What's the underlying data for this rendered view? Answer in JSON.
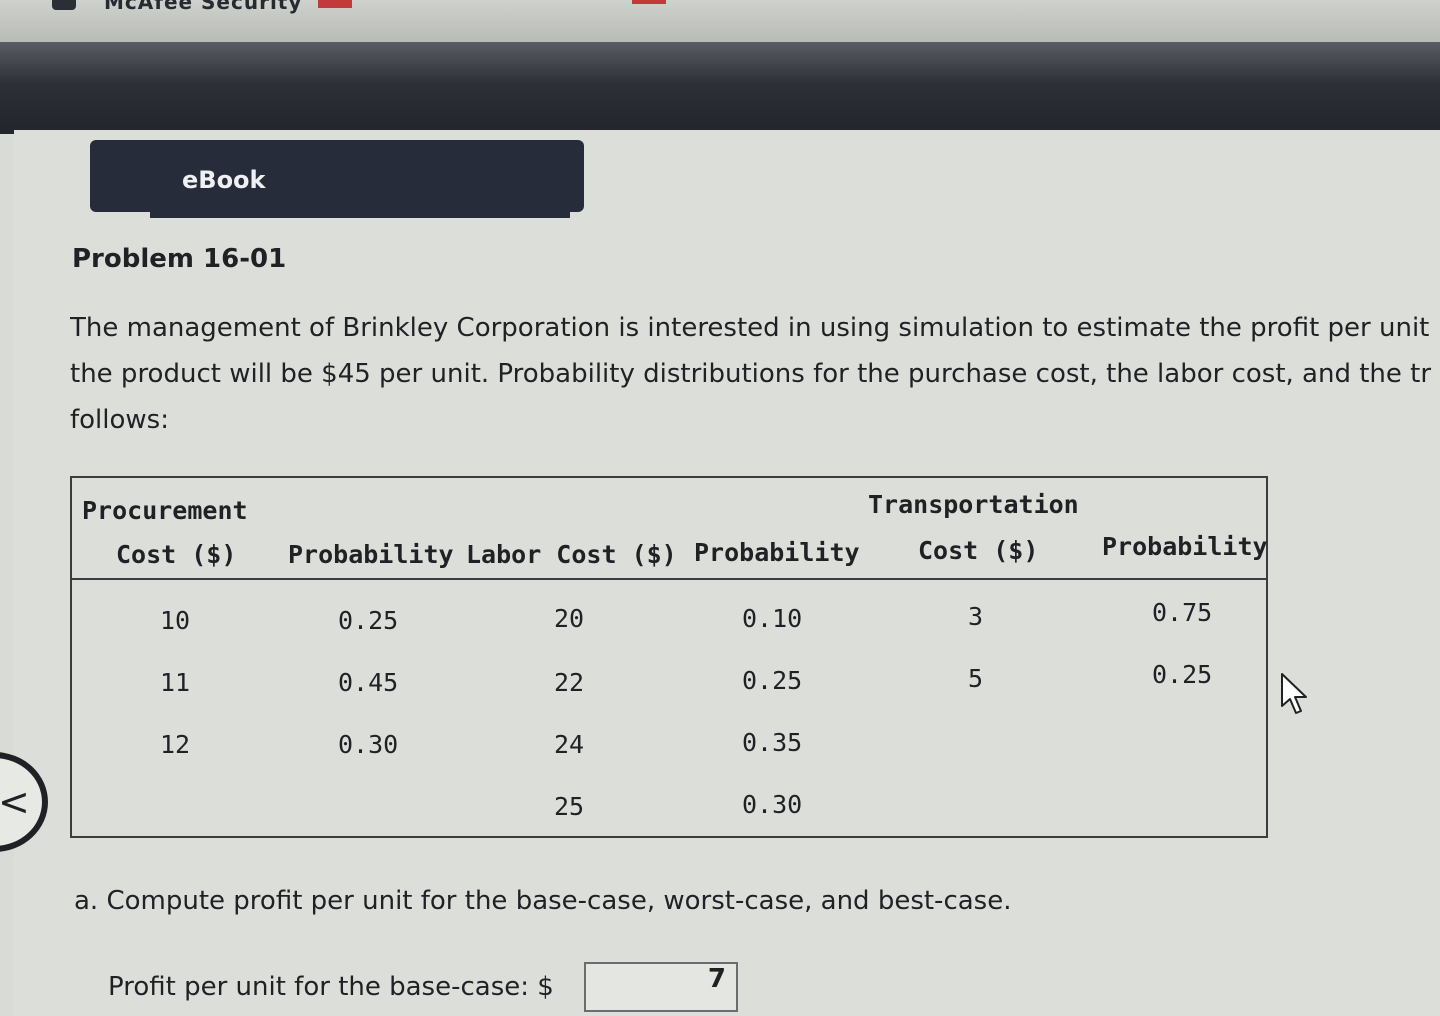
{
  "browser": {
    "brand": "McAfee Security"
  },
  "ebook": {
    "label": "eBook"
  },
  "problem": {
    "title": "Problem 16-01",
    "lines": [
      "The management of Brinkley Corporation is interested in using simulation to estimate the profit per unit",
      "the product will be $45 per unit. Probability distributions for the purchase cost, the labor cost, and the tr",
      "follows:"
    ]
  },
  "table": {
    "headers": {
      "c1a": "Procurement",
      "c1b": "Cost ($)",
      "c2": "Probability",
      "c3": "Labor Cost ($)",
      "c4": "Probability",
      "c5a": "Transportation",
      "c5b": "Cost ($)",
      "c6": "Probability"
    },
    "rows": [
      [
        "10",
        "0.25",
        "20",
        "0.10",
        "3",
        "0.75"
      ],
      [
        "11",
        "0.45",
        "22",
        "0.25",
        "5",
        "0.25"
      ],
      [
        "12",
        "0.30",
        "24",
        "0.35",
        "",
        ""
      ],
      [
        "",
        "",
        "25",
        "0.30",
        "",
        ""
      ]
    ]
  },
  "question": {
    "text": "a. Compute profit per unit for the base-case, worst-case, and best-case."
  },
  "answer": {
    "label": "Profit per unit for the base-case: $",
    "value": "7"
  },
  "icons": {
    "prev": "<",
    "cursor": "mouse-pointer-icon"
  }
}
